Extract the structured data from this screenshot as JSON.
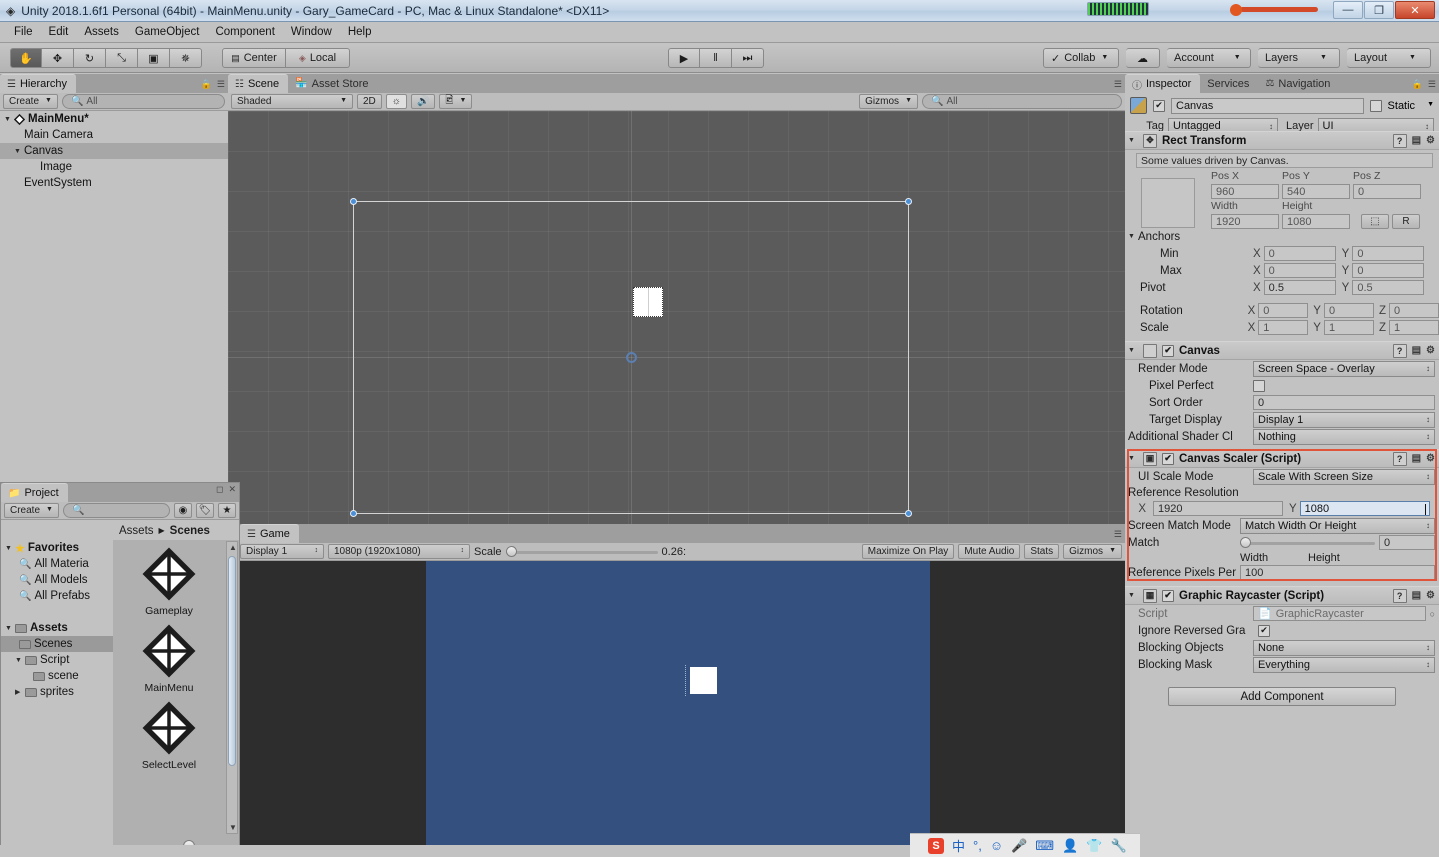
{
  "window": {
    "title": "Unity 2018.1.6f1 Personal (64bit) - MainMenu.unity - Gary_GameCard - PC, Mac & Linux Standalone* <DX11>",
    "icon": "unity-logo-icon",
    "minimize": "—",
    "maximize": "❐",
    "close": "✕"
  },
  "menubar": {
    "items": [
      "File",
      "Edit",
      "Assets",
      "GameObject",
      "Component",
      "Window",
      "Help"
    ]
  },
  "toolbar": {
    "tools": [
      {
        "name": "hand-tool",
        "glyph": "✋",
        "active": true
      },
      {
        "name": "move-tool",
        "glyph": "✥",
        "active": false
      },
      {
        "name": "rotate-tool",
        "glyph": "↻",
        "active": false
      },
      {
        "name": "scale-tool",
        "glyph": "⤡",
        "active": false
      },
      {
        "name": "rect-tool",
        "glyph": "▣",
        "active": false
      },
      {
        "name": "transform-tool",
        "glyph": "✵",
        "active": false
      }
    ],
    "pivot_mode": "Center",
    "pivot_rotation": "Local",
    "play": "▶",
    "pause": "‖",
    "step": "⏭",
    "collab": "Collab",
    "cloud_icon": "cloud-icon",
    "account": "Account",
    "layers": "Layers",
    "layout": "Layout"
  },
  "hierarchy": {
    "tab": "Hierarchy",
    "create": "Create",
    "search_placeholder": "All",
    "scene_name": "MainMenu*",
    "items": [
      {
        "label": "Main Camera",
        "depth": 1,
        "expandable": false,
        "selected": false
      },
      {
        "label": "Canvas",
        "depth": 1,
        "expandable": true,
        "selected": true
      },
      {
        "label": "Image",
        "depth": 2,
        "expandable": false,
        "selected": false
      },
      {
        "label": "EventSystem",
        "depth": 1,
        "expandable": false,
        "selected": false
      }
    ]
  },
  "scene": {
    "tabs": [
      {
        "label": "Scene",
        "active": true
      },
      {
        "label": "Asset Store",
        "active": false
      }
    ],
    "draw_mode": "Shaded",
    "mode_2d": "2D",
    "lighting_icon": "sun-icon",
    "audio_icon": "speaker-icon",
    "effects_icon": "image-icon",
    "gizmos": "Gizmos",
    "search_placeholder": "All"
  },
  "game": {
    "tab": "Game",
    "display": "Display 1",
    "resolution": "1080p (1920x1080)",
    "scale_label": "Scale",
    "scale_value": "0.26:",
    "maximize_on_play": "Maximize On Play",
    "mute_audio": "Mute Audio",
    "stats": "Stats",
    "gizmos": "Gizmos",
    "background_color": "#34507e"
  },
  "project": {
    "tab": "Project",
    "create": "Create",
    "search_placeholder": "",
    "breadcrumb": [
      "Assets",
      "Scenes"
    ],
    "tree": [
      {
        "label": "Favorites",
        "depth": 0,
        "bold": true,
        "icon": "star-icon",
        "expandable": true,
        "selected": false
      },
      {
        "label": "All Materia",
        "depth": 1,
        "bold": false,
        "icon": "search-icon",
        "expandable": false,
        "selected": false
      },
      {
        "label": "All Models",
        "depth": 1,
        "bold": false,
        "icon": "search-icon",
        "expandable": false,
        "selected": false
      },
      {
        "label": "All Prefabs",
        "depth": 1,
        "bold": false,
        "icon": "search-icon",
        "expandable": false,
        "selected": false
      },
      {
        "label": "",
        "depth": 0,
        "bold": false,
        "icon": "none",
        "expandable": false,
        "selected": false
      },
      {
        "label": "Assets",
        "depth": 0,
        "bold": true,
        "icon": "folder-icon",
        "expandable": true,
        "selected": false
      },
      {
        "label": "Scenes",
        "depth": 1,
        "bold": false,
        "icon": "folder-icon",
        "expandable": false,
        "selected": true
      },
      {
        "label": "Script",
        "depth": 1,
        "bold": false,
        "icon": "folder-icon",
        "expandable": true,
        "selected": false
      },
      {
        "label": "scene",
        "depth": 2,
        "bold": false,
        "icon": "folder-icon",
        "expandable": false,
        "selected": false
      },
      {
        "label": "sprites",
        "depth": 1,
        "bold": false,
        "icon": "folder-icon",
        "expandable": true,
        "selected": false
      }
    ],
    "assets": [
      {
        "label": "Gameplay",
        "icon": "unity-scene-icon"
      },
      {
        "label": "MainMenu",
        "icon": "unity-scene-icon"
      },
      {
        "label": "SelectLevel",
        "icon": "unity-scene-icon"
      }
    ]
  },
  "inspector": {
    "tabs": [
      {
        "label": "Inspector",
        "active": true,
        "icon": "info-icon"
      },
      {
        "label": "Services",
        "active": false,
        "icon": ""
      },
      {
        "label": "Navigation",
        "active": false,
        "icon": "navmesh-icon"
      }
    ],
    "object_name": "Canvas",
    "object_enabled": true,
    "static_label": "Static",
    "static_checked": false,
    "tag_label": "Tag",
    "tag_value": "Untagged",
    "layer_label": "Layer",
    "layer_value": "UI",
    "rect_transform": {
      "title": "Rect Transform",
      "note": "Some values driven by Canvas.",
      "headers": [
        "Pos X",
        "Pos Y",
        "Pos Z"
      ],
      "pos": [
        "960",
        "540",
        "0"
      ],
      "size_headers": [
        "Width",
        "Height"
      ],
      "size": [
        "1920",
        "1080"
      ],
      "blueprint_btn": "⬚",
      "raw_btn": "R",
      "anchors_label": "Anchors",
      "min_label": "Min",
      "min": {
        "x": "0",
        "y": "0"
      },
      "max_label": "Max",
      "max": {
        "x": "0",
        "y": "0"
      },
      "pivot_label": "Pivot",
      "pivot": {
        "x": "0.5",
        "y": "0.5"
      },
      "rotation_label": "Rotation",
      "rotation": {
        "x": "0",
        "y": "0",
        "z": "0"
      },
      "scale_label": "Scale",
      "scale": {
        "x": "1",
        "y": "1",
        "z": "1"
      }
    },
    "canvas": {
      "title": "Canvas",
      "enabled": true,
      "render_mode_label": "Render Mode",
      "render_mode": "Screen Space - Overlay",
      "pixel_perfect_label": "Pixel Perfect",
      "pixel_perfect": false,
      "sort_order_label": "Sort Order",
      "sort_order": "0",
      "target_display_label": "Target Display",
      "target_display": "Display 1",
      "shader_channels_label": "Additional Shader Cl",
      "shader_channels": "Nothing"
    },
    "canvas_scaler": {
      "title": "Canvas Scaler (Script)",
      "enabled": true,
      "ui_scale_mode_label": "UI Scale Mode",
      "ui_scale_mode": "Scale With Screen Size",
      "reference_resolution_label": "Reference Resolution",
      "ref_x": "1920",
      "ref_y": "1080",
      "screen_match_mode_label": "Screen Match Mode",
      "screen_match_mode": "Match Width Or Height",
      "match_label": "Match",
      "match_value": "0",
      "match_min_label": "Width",
      "match_max_label": "Height",
      "ref_pixels_label": "Reference Pixels Per",
      "ref_pixels": "100",
      "highlight_color": "#e0543c"
    },
    "graphic_raycaster": {
      "title": "Graphic Raycaster (Script)",
      "enabled": true,
      "script_label": "Script",
      "script_value": "GraphicRaycaster",
      "ignore_reversed_label": "Ignore Reversed Gra",
      "ignore_reversed": true,
      "blocking_objects_label": "Blocking Objects",
      "blocking_objects": "None",
      "blocking_mask_label": "Blocking Mask",
      "blocking_mask": "Everything"
    },
    "add_component": "Add Component"
  },
  "ime": {
    "app_icon": "sogou-icon",
    "mode": "中",
    "punct": "°,",
    "emoji": "☺",
    "mic": "Ἲ4",
    "keyboard": "⌨",
    "user": "὆4",
    "shirt": "shirt-icon",
    "tools": "wrench-icon"
  }
}
